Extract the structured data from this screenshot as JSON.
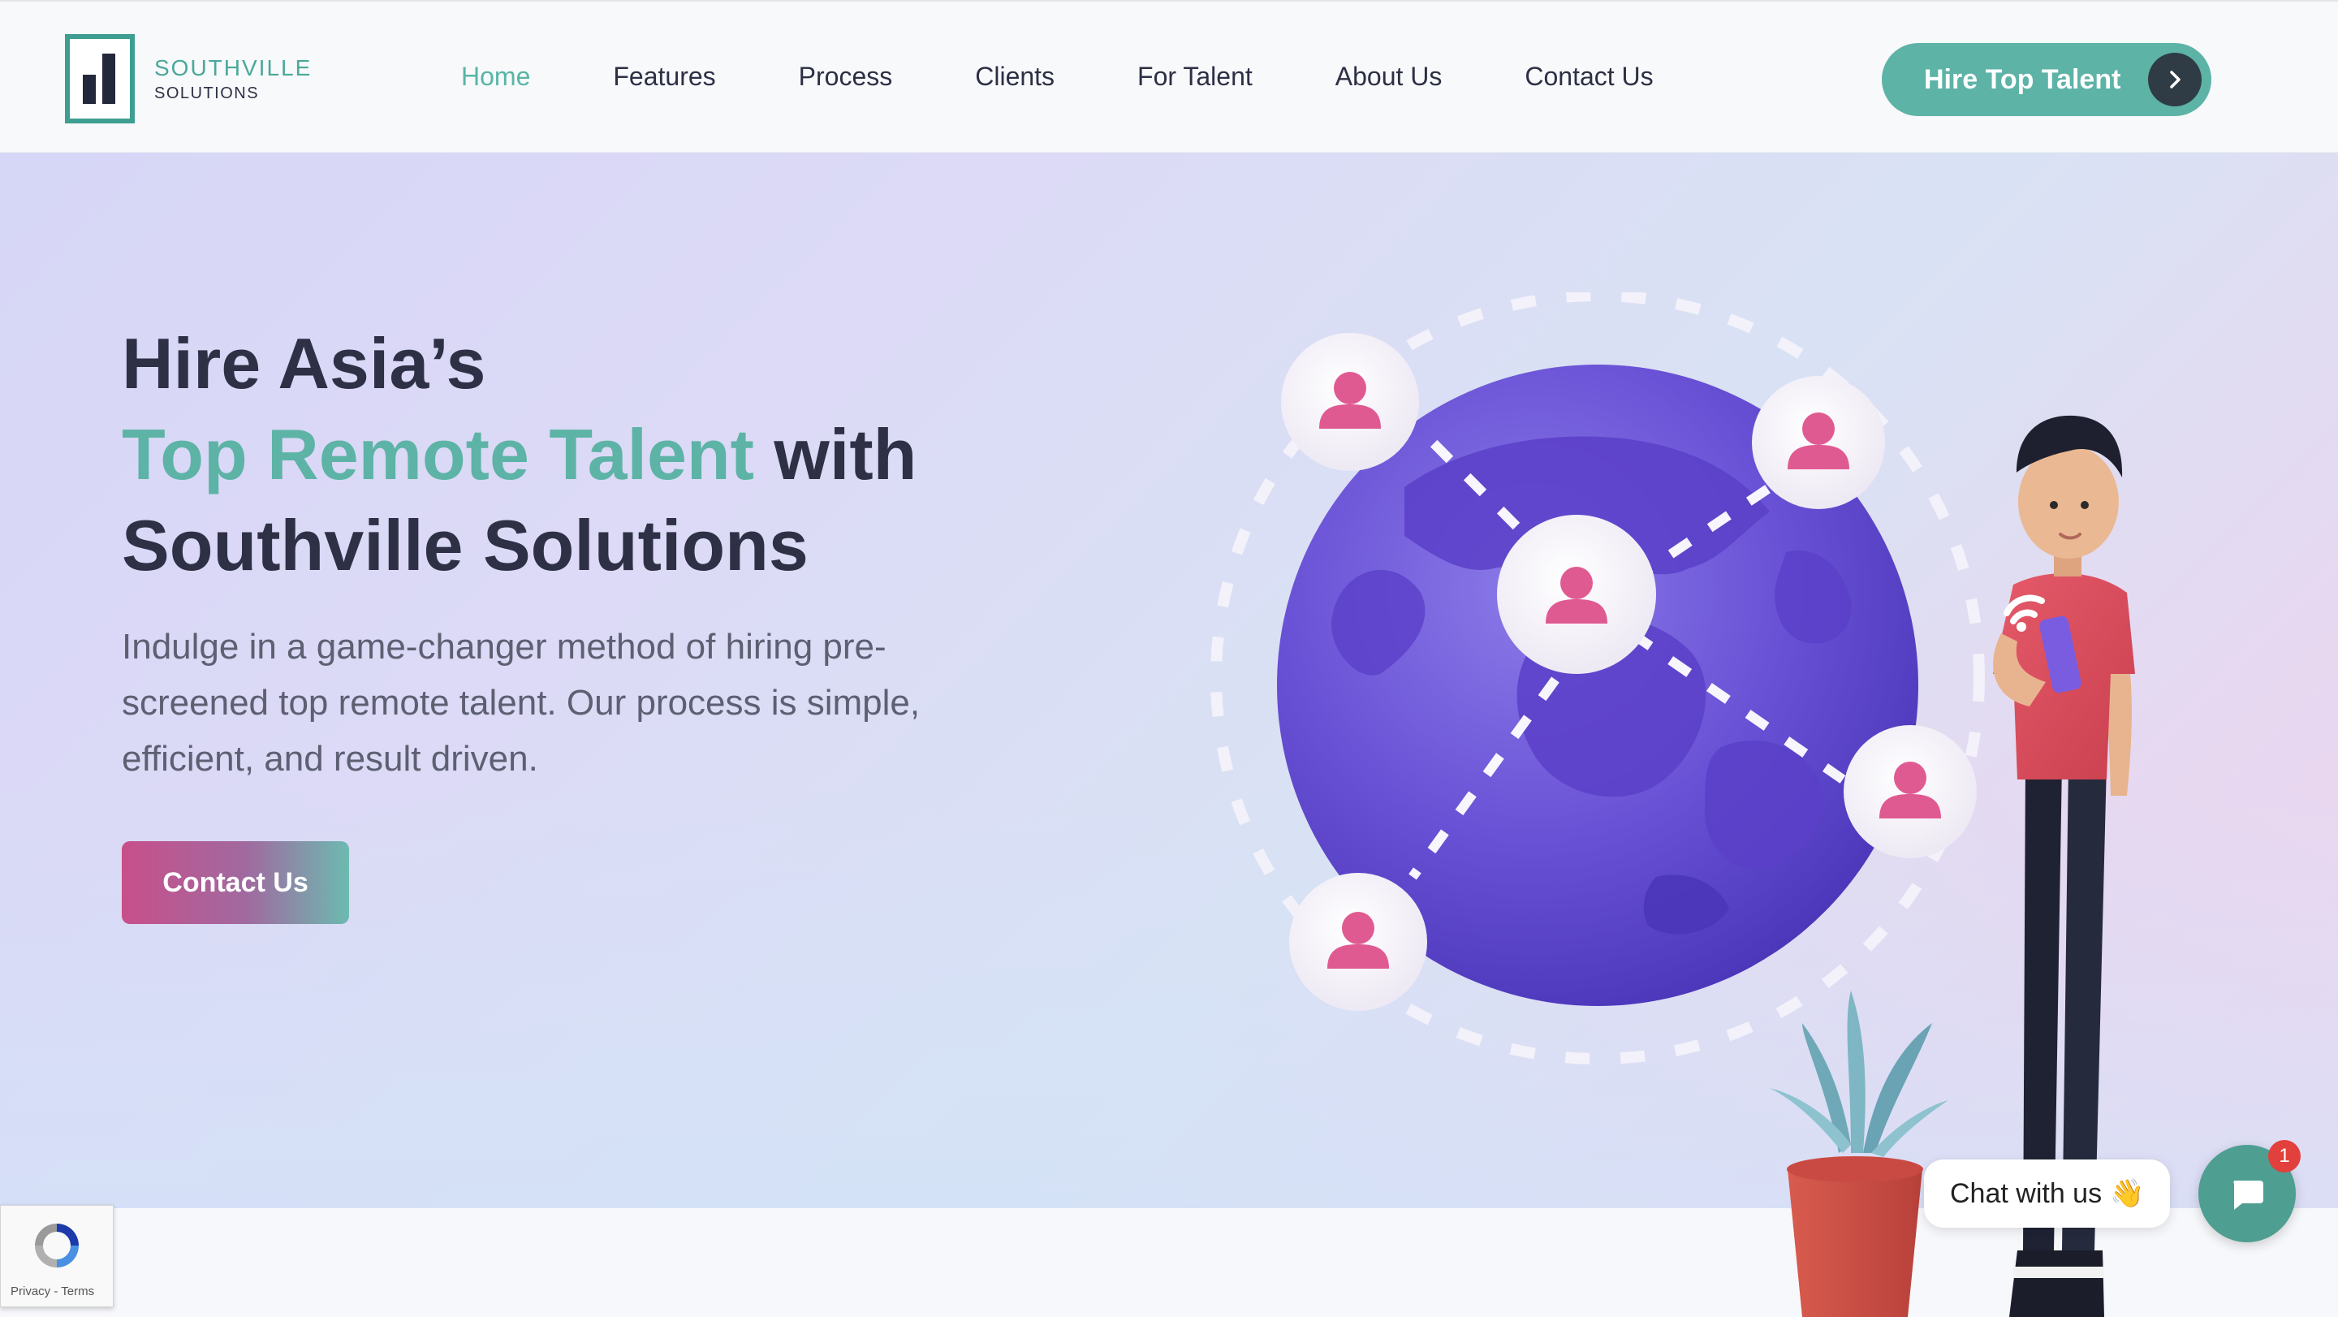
{
  "header": {
    "logo": {
      "line1": "SOUTHVILLE",
      "line2": "SOLUTIONS"
    },
    "nav": [
      {
        "label": "Home",
        "active": true
      },
      {
        "label": "Features"
      },
      {
        "label": "Process"
      },
      {
        "label": "Clients"
      },
      {
        "label": "For Talent"
      },
      {
        "label": "About Us"
      },
      {
        "label": "Contact Us"
      }
    ],
    "cta": {
      "label": "Hire Top Talent",
      "icon": "chevron-right-icon"
    }
  },
  "hero": {
    "headline_line1": "Hire Asia’s",
    "headline_accent": "Top Remote Talent",
    "headline_line2_rest": " with",
    "headline_line3": "Southville Solutions",
    "subtext": "Indulge in a game-changer method of hiring pre-screened top remote talent. Our process is simple, efficient, and result driven.",
    "button": "Contact Us"
  },
  "recaptcha": {
    "links": "Privacy - Terms"
  },
  "chat": {
    "bubble": "Chat with us",
    "emoji": "👋",
    "badge": "1"
  },
  "colors": {
    "accent": "#5db3a6",
    "pink": "#e0588f",
    "globe": "#6a52d6",
    "text": "#2d3044"
  }
}
